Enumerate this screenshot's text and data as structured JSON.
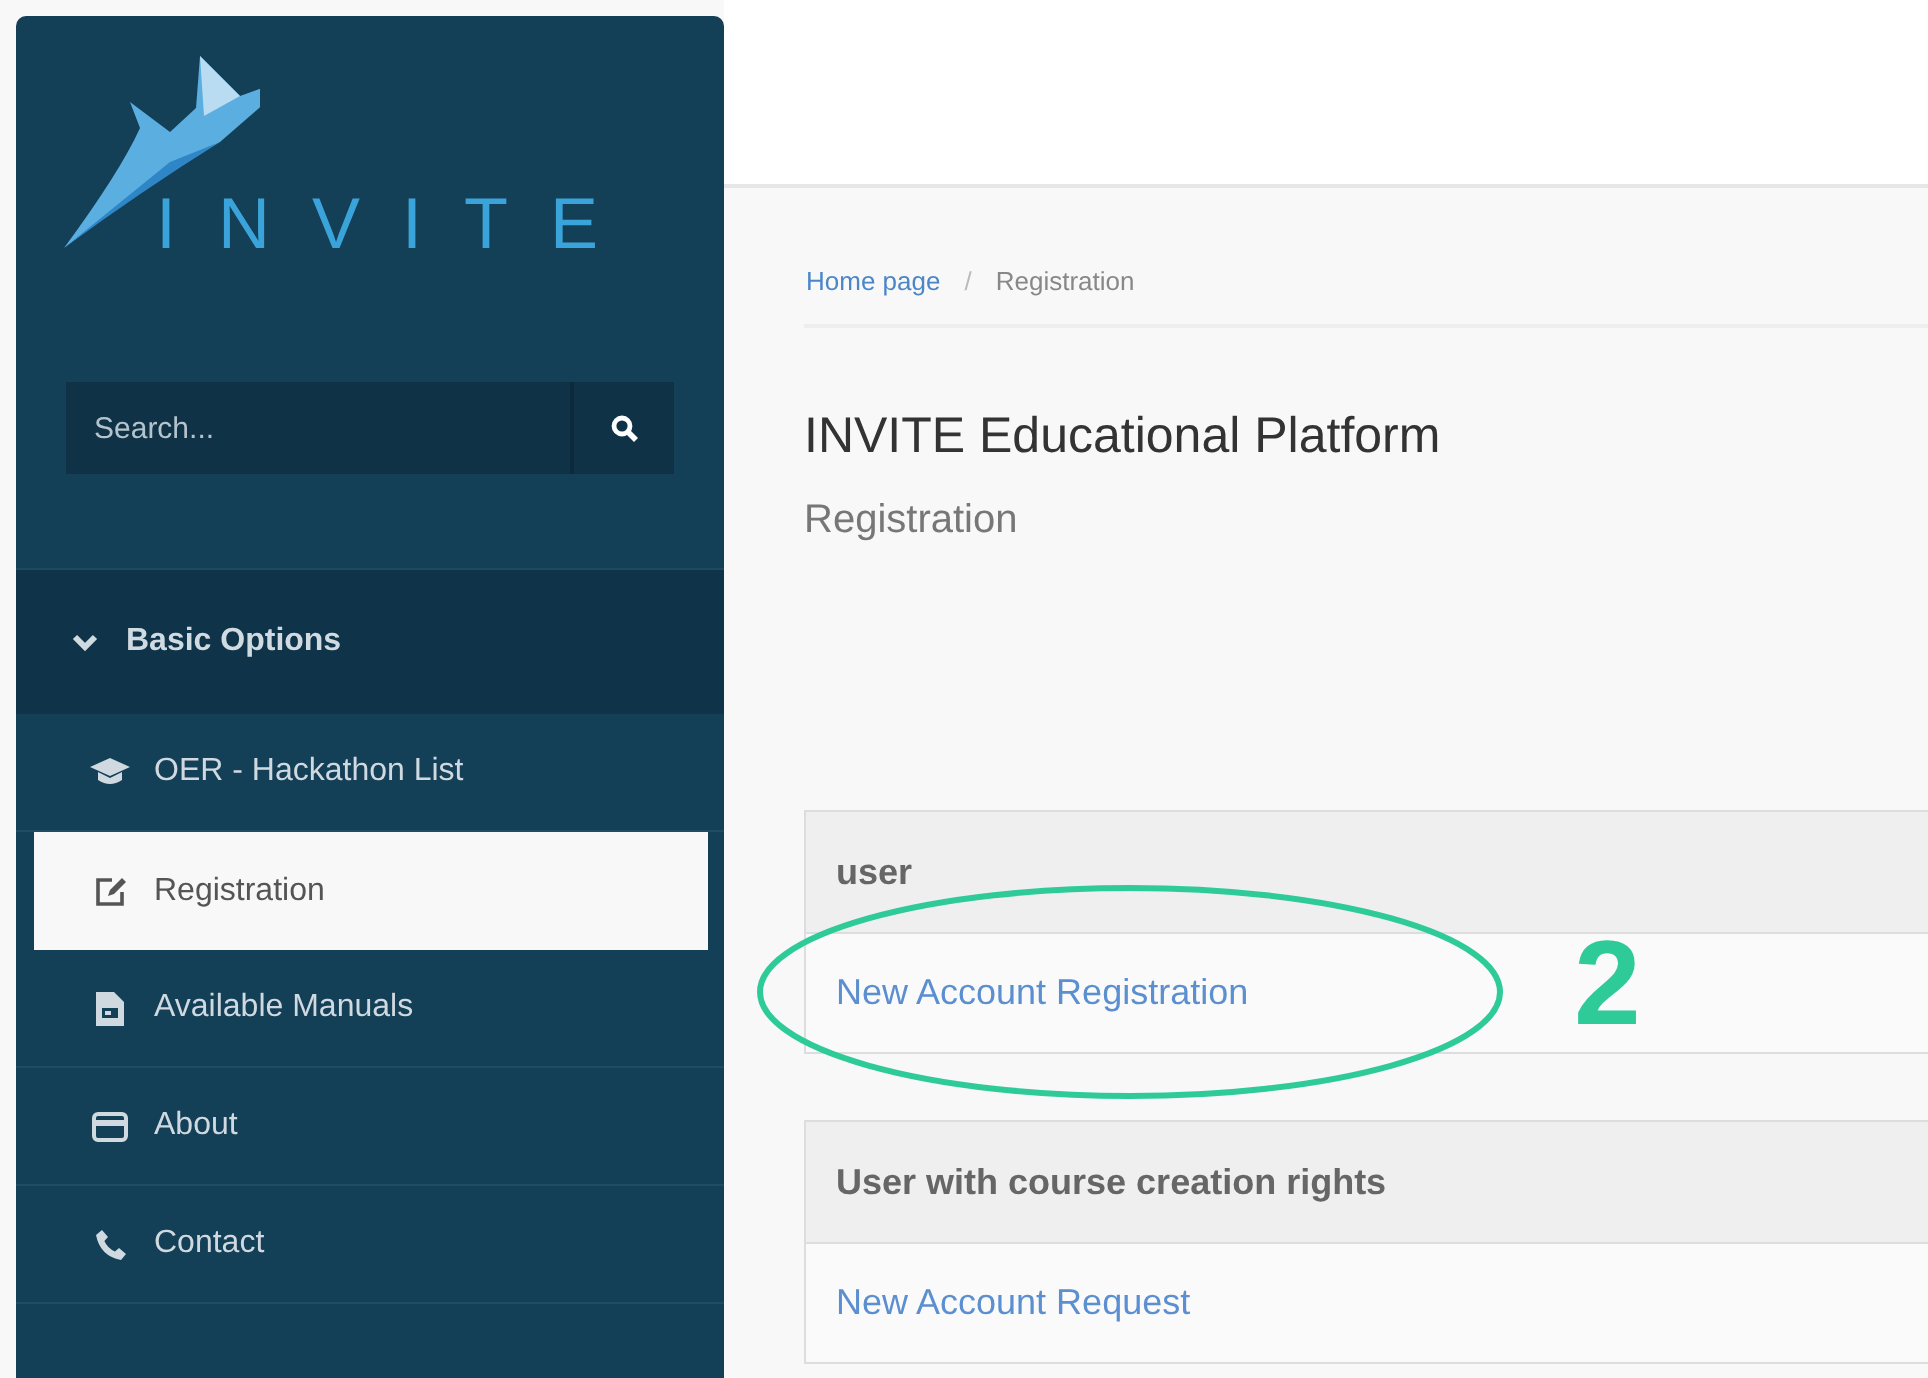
{
  "logo": {
    "text": "INVITE"
  },
  "search": {
    "placeholder": "Search..."
  },
  "sidebar": {
    "section": {
      "label": "Basic Options",
      "expanded": true
    },
    "items": [
      {
        "label": "OER - Hackathon List",
        "kind": "graduation",
        "selected": false
      },
      {
        "label": "Registration",
        "kind": "edit",
        "selected": true
      },
      {
        "label": "Available Manuals",
        "kind": "document",
        "selected": false
      },
      {
        "label": "About",
        "kind": "card",
        "selected": false
      },
      {
        "label": "Contact",
        "kind": "phone",
        "selected": false
      }
    ]
  },
  "breadcrumb": {
    "items": [
      {
        "label": "Home page",
        "kind": "link"
      },
      {
        "label": "Registration",
        "kind": "current"
      }
    ],
    "separator": "/"
  },
  "title": "INVITE Educational Platform",
  "subtitle": "Registration",
  "panels": [
    {
      "heading": "user",
      "link": "New Account Registration"
    },
    {
      "heading": "User with course creation rights",
      "link": "New Account Request"
    }
  ],
  "annotation": {
    "number": "2"
  }
}
